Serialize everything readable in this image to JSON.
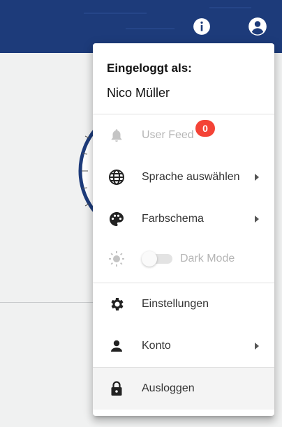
{
  "topbar": {
    "color": "#1d3b7a",
    "info_icon": "info-icon",
    "account_icon": "account-circle-icon"
  },
  "menu": {
    "header": {
      "title": "Eingeloggt als:",
      "user": "Nico Müller"
    },
    "items": [
      {
        "label": "User Feed",
        "icon": "bell-icon",
        "disabled": true,
        "badge": "0"
      },
      {
        "label": "Sprache auswählen",
        "icon": "globe-icon",
        "submenu": true
      },
      {
        "label": "Farbschema",
        "icon": "palette-icon",
        "submenu": true
      },
      {
        "label": "Dark Mode",
        "icon": "sun-icon",
        "disabled": true,
        "toggle": false
      },
      {
        "label": "Einstellungen",
        "icon": "gear-icon"
      },
      {
        "label": "Konto",
        "icon": "person-icon",
        "submenu": true
      },
      {
        "label": "Ausloggen",
        "icon": "lock-icon"
      }
    ]
  },
  "colors": {
    "badge": "#f44336",
    "topbar": "#1d3b7a",
    "background": "#f0f1f1"
  }
}
